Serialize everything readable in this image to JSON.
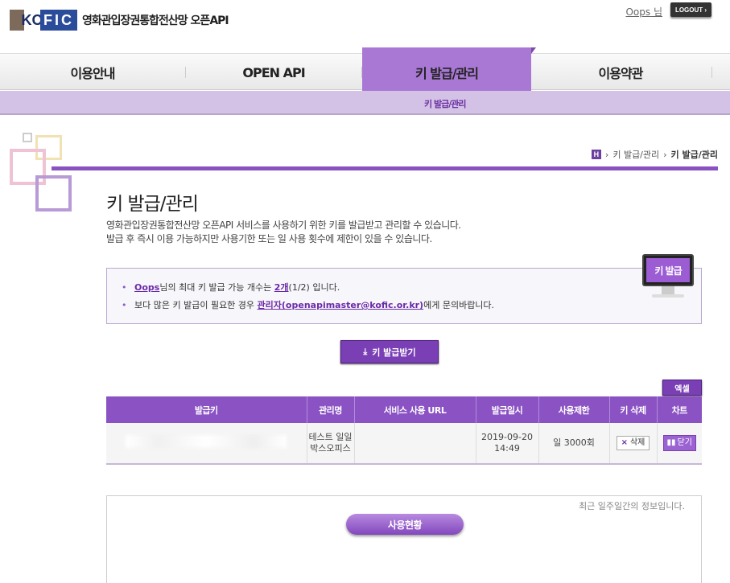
{
  "header": {
    "logo_text_left": "KO",
    "logo_text_right": "FIC",
    "site_title": "영화관입장권통합전산망 오픈API",
    "user_name": "Oops",
    "user_suffix": " 님",
    "logout_label": "LOGOUT ›"
  },
  "nav": {
    "tabs": [
      {
        "label": "이용안내"
      },
      {
        "label": "OPEN API"
      },
      {
        "label": "키 발급/관리"
      },
      {
        "label": "이용약관"
      }
    ],
    "sub_item": "키 발급/관리"
  },
  "breadcrumb": {
    "home": "H",
    "item1": "키 발급/관리",
    "item2": "키 발급/관리"
  },
  "page": {
    "title": "키 발급/관리",
    "desc_line1": "영화관입장권통합전산망 오픈API 서비스를 사용하기 위한 키를 발급받고 관리할 수 있습니다.",
    "desc_line2": "발급 후 즉시 이용 가능하지만 사용기한 또는 일 사용 횟수에 제한이 있을 수 있습니다."
  },
  "info": {
    "line1_user": "Oops",
    "line1_mid": "님의 최대 키 발급 가능 개수는 ",
    "line1_count": "2개",
    "line1_end": "(1/2) 입니다.",
    "line2_start": "보다 많은 키 발급이 필요한 경우 ",
    "line2_link": "관리자(openapimaster@kofic.or.kr)",
    "line2_end": "에게 문의바랍니다.",
    "monitor_label": "키 발급"
  },
  "buttons": {
    "issue_label": "키 발급받기",
    "excel_label": "엑셀"
  },
  "table": {
    "headers": [
      "발급키",
      "관리명",
      "서비스 사용 URL",
      "발급일시",
      "사용제한",
      "키 삭제",
      "차트"
    ],
    "rows": [
      {
        "key": "",
        "name": "테스트 일일박스오피스",
        "url": "",
        "date": "2019-09-20 14:49",
        "limit": "일 3000회",
        "delete_label": "삭제",
        "chart_label": "닫기"
      }
    ]
  },
  "usage": {
    "note": "최근 일주일간의 정보입니다.",
    "button_label": "사용현황"
  },
  "colors": {
    "accent": "#8a52c3",
    "accent_dark": "#7a3fb5",
    "subnav": "#d4c2e6"
  }
}
